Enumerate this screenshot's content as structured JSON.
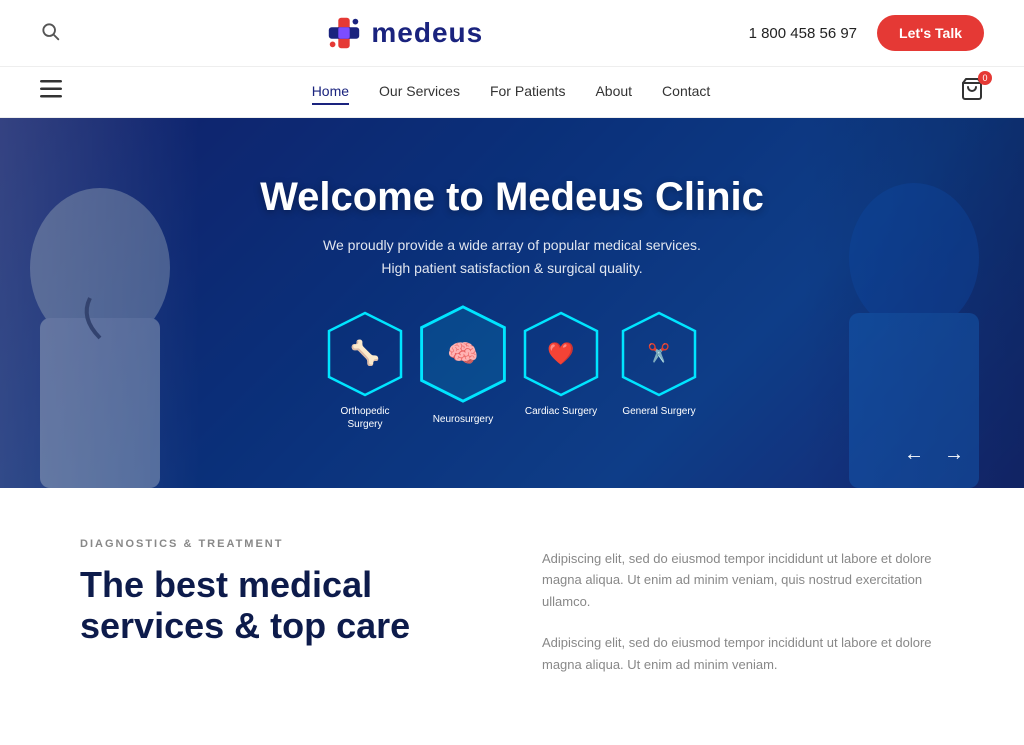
{
  "header": {
    "phone": "1 800 458 56 97",
    "lets_talk": "Let's Talk",
    "logo_text": "medeus"
  },
  "nav": {
    "items": [
      {
        "label": "Home",
        "active": true
      },
      {
        "label": "Our Services",
        "active": false
      },
      {
        "label": "For Patients",
        "active": false
      },
      {
        "label": "About",
        "active": false
      },
      {
        "label": "Contact",
        "active": false
      }
    ],
    "cart_count": "0"
  },
  "hero": {
    "title": "Welcome to Medeus Clinic",
    "subtitle_line1": "We proudly provide a wide array of popular medical services.",
    "subtitle_line2": "High patient satisfaction & surgical quality.",
    "services": [
      {
        "label": "Orthopedic Surgery",
        "icon": "🦴"
      },
      {
        "label": "Neurosurgery",
        "icon": "🧠"
      },
      {
        "label": "Cardiac Surgery",
        "icon": "❤"
      },
      {
        "label": "General Surgery",
        "icon": "✂"
      }
    ]
  },
  "content": {
    "label": "DIAGNOSTICS & TREATMENT",
    "title_line1": "The best medical",
    "title_line2": "services & top care",
    "paragraph1": "Adipiscing elit, sed do eiusmod tempor incididunt ut labore et dolore magna aliqua. Ut enim ad minim veniam, quis nostrud exercitation ullamco.",
    "paragraph2": "Adipiscing elit, sed do eiusmod tempor incididunt ut labore et dolore magna aliqua. Ut enim ad minim veniam."
  },
  "colors": {
    "accent_red": "#e53935",
    "accent_blue": "#1a237e",
    "accent_cyan": "#00e5ff"
  }
}
